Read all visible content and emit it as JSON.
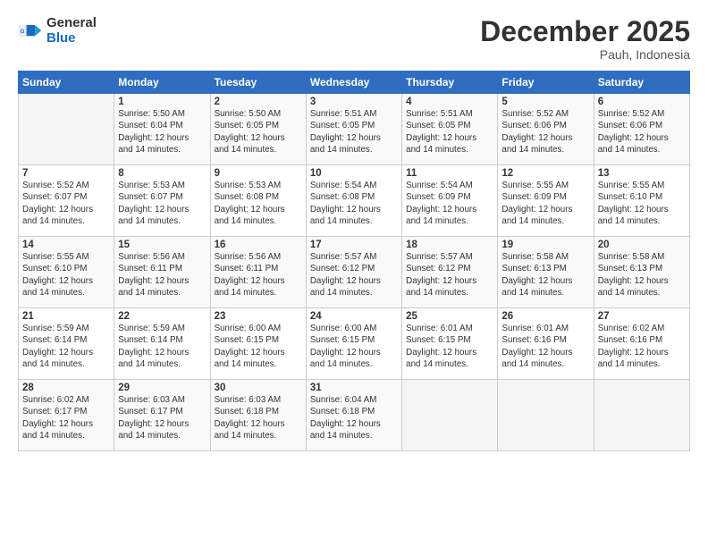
{
  "logo": {
    "general": "General",
    "blue": "Blue"
  },
  "header": {
    "title": "December 2025",
    "location": "Pauh, Indonesia"
  },
  "calendar": {
    "days_of_week": [
      "Sunday",
      "Monday",
      "Tuesday",
      "Wednesday",
      "Thursday",
      "Friday",
      "Saturday"
    ],
    "weeks": [
      [
        {
          "date": "",
          "info": ""
        },
        {
          "date": "1",
          "info": "Sunrise: 5:50 AM\nSunset: 6:04 PM\nDaylight: 12 hours\nand 14 minutes."
        },
        {
          "date": "2",
          "info": "Sunrise: 5:50 AM\nSunset: 6:05 PM\nDaylight: 12 hours\nand 14 minutes."
        },
        {
          "date": "3",
          "info": "Sunrise: 5:51 AM\nSunset: 6:05 PM\nDaylight: 12 hours\nand 14 minutes."
        },
        {
          "date": "4",
          "info": "Sunrise: 5:51 AM\nSunset: 6:05 PM\nDaylight: 12 hours\nand 14 minutes."
        },
        {
          "date": "5",
          "info": "Sunrise: 5:52 AM\nSunset: 6:06 PM\nDaylight: 12 hours\nand 14 minutes."
        },
        {
          "date": "6",
          "info": "Sunrise: 5:52 AM\nSunset: 6:06 PM\nDaylight: 12 hours\nand 14 minutes."
        }
      ],
      [
        {
          "date": "7",
          "info": ""
        },
        {
          "date": "8",
          "info": "Sunrise: 5:53 AM\nSunset: 6:07 PM\nDaylight: 12 hours\nand 14 minutes."
        },
        {
          "date": "9",
          "info": "Sunrise: 5:53 AM\nSunset: 6:08 PM\nDaylight: 12 hours\nand 14 minutes."
        },
        {
          "date": "10",
          "info": "Sunrise: 5:54 AM\nSunset: 6:08 PM\nDaylight: 12 hours\nand 14 minutes."
        },
        {
          "date": "11",
          "info": "Sunrise: 5:54 AM\nSunset: 6:09 PM\nDaylight: 12 hours\nand 14 minutes."
        },
        {
          "date": "12",
          "info": "Sunrise: 5:55 AM\nSunset: 6:09 PM\nDaylight: 12 hours\nand 14 minutes."
        },
        {
          "date": "13",
          "info": "Sunrise: 5:55 AM\nSunset: 6:10 PM\nDaylight: 12 hours\nand 14 minutes."
        }
      ],
      [
        {
          "date": "14",
          "info": ""
        },
        {
          "date": "15",
          "info": "Sunrise: 5:56 AM\nSunset: 6:11 PM\nDaylight: 12 hours\nand 14 minutes."
        },
        {
          "date": "16",
          "info": "Sunrise: 5:56 AM\nSunset: 6:11 PM\nDaylight: 12 hours\nand 14 minutes."
        },
        {
          "date": "17",
          "info": "Sunrise: 5:57 AM\nSunset: 6:12 PM\nDaylight: 12 hours\nand 14 minutes."
        },
        {
          "date": "18",
          "info": "Sunrise: 5:57 AM\nSunset: 6:12 PM\nDaylight: 12 hours\nand 14 minutes."
        },
        {
          "date": "19",
          "info": "Sunrise: 5:58 AM\nSunset: 6:13 PM\nDaylight: 12 hours\nand 14 minutes."
        },
        {
          "date": "20",
          "info": "Sunrise: 5:58 AM\nSunset: 6:13 PM\nDaylight: 12 hours\nand 14 minutes."
        }
      ],
      [
        {
          "date": "21",
          "info": ""
        },
        {
          "date": "22",
          "info": "Sunrise: 5:59 AM\nSunset: 6:14 PM\nDaylight: 12 hours\nand 14 minutes."
        },
        {
          "date": "23",
          "info": "Sunrise: 6:00 AM\nSunset: 6:15 PM\nDaylight: 12 hours\nand 14 minutes."
        },
        {
          "date": "24",
          "info": "Sunrise: 6:00 AM\nSunset: 6:15 PM\nDaylight: 12 hours\nand 14 minutes."
        },
        {
          "date": "25",
          "info": "Sunrise: 6:01 AM\nSunset: 6:15 PM\nDaylight: 12 hours\nand 14 minutes."
        },
        {
          "date": "26",
          "info": "Sunrise: 6:01 AM\nSunset: 6:16 PM\nDaylight: 12 hours\nand 14 minutes."
        },
        {
          "date": "27",
          "info": "Sunrise: 6:02 AM\nSunset: 6:16 PM\nDaylight: 12 hours\nand 14 minutes."
        }
      ],
      [
        {
          "date": "28",
          "info": ""
        },
        {
          "date": "29",
          "info": "Sunrise: 6:03 AM\nSunset: 6:17 PM\nDaylight: 12 hours\nand 14 minutes."
        },
        {
          "date": "30",
          "info": "Sunrise: 6:03 AM\nSunset: 6:18 PM\nDaylight: 12 hours\nand 14 minutes."
        },
        {
          "date": "31",
          "info": "Sunrise: 6:04 AM\nSunset: 6:18 PM\nDaylight: 12 hours\nand 14 minutes."
        },
        {
          "date": "",
          "info": ""
        },
        {
          "date": "",
          "info": ""
        },
        {
          "date": "",
          "info": ""
        }
      ]
    ],
    "week1_sun_info": "Sunrise: 5:52 AM\nSunset: 6:07 PM\nDaylight: 12 hours\nand 14 minutes.",
    "week2_sun_info": "Sunrise: 5:55 AM\nSunset: 6:10 PM\nDaylight: 12 hours\nand 14 minutes.",
    "week3_sun_info": "Sunrise: 5:59 AM\nSunset: 6:14 PM\nDaylight: 12 hours\nand 14 minutes.",
    "week4_sun_info": "Sunrise: 6:02 AM\nSunset: 6:17 PM\nDaylight: 12 hours\nand 14 minutes."
  }
}
